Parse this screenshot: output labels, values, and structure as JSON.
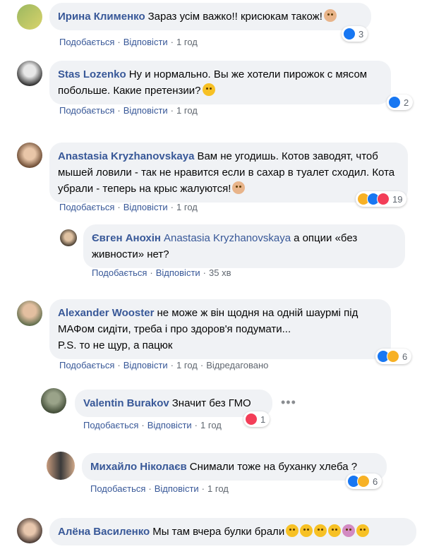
{
  "colors": {
    "link": "#385898",
    "bubble": "#f0f2f5",
    "meta": "#606770",
    "like": "#1877f2",
    "haha": "#f7b125",
    "love": "#f33e58"
  },
  "labels": {
    "like": "Подобається",
    "reply": "Відповісти",
    "dot": "·"
  },
  "comments": [
    {
      "author": "Ирина Клименко",
      "text": "Зараз усім важко!! крисюкам також!",
      "time": "1 год",
      "reactions": {
        "icons": [
          "like-icon"
        ],
        "count": "3"
      }
    },
    {
      "author": "Stas Lozenko",
      "text": "Ну и нормально. Вы же хотели пирожок с мясом побольше. Какие претензии?",
      "time": "1 год",
      "reactions": {
        "icons": [
          "like-icon"
        ],
        "count": "2"
      }
    },
    {
      "author": "Anastasia Kryzhanovskaya",
      "text": "Вам не угодишь. Котов заводят, чтоб мышей ловили - так не нравится если в сахар в туалет сходил. Кота убрали - теперь на крыс жалуются!",
      "time": "1 год",
      "reactions": {
        "icons": [
          "haha-icon",
          "like-icon",
          "love-icon"
        ],
        "count": "19"
      }
    },
    {
      "author": "Євген Анохін",
      "mention": "Anastasia Kryzhanovskaya",
      "text": "а опции «без живности» нет?",
      "time": "35 хв"
    },
    {
      "author": "Alexander Wooster",
      "text": "не може ж він щодня на одній шаурмі під МАФом сидіти, треба і про здоров'я подумати...",
      "text2": "P.S. то не щур, а пацюк",
      "time": "1 год",
      "edited": "Відредаговано",
      "reactions": {
        "icons": [
          "like-icon",
          "haha-icon"
        ],
        "count": "6"
      }
    },
    {
      "author": "Valentin Burakov",
      "text": "Значит без ГМО",
      "time": "1 год",
      "reactions": {
        "icons": [
          "love-icon"
        ],
        "count": "1"
      }
    },
    {
      "author": "Михайло Ніколаєв",
      "text": "Снимали тоже на буханку хлеба ?",
      "time": "1 год",
      "reactions": {
        "icons": [
          "like-icon",
          "haha-icon"
        ],
        "count": "6"
      }
    },
    {
      "author": "Алёна Василенко",
      "text": "Мы там вчера булки брали"
    }
  ]
}
